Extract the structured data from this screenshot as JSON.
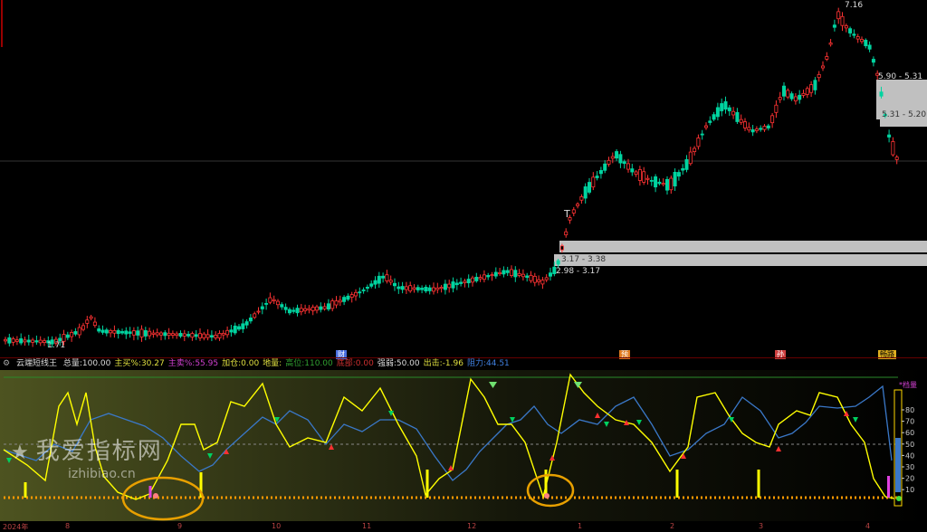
{
  "main_chart": {
    "price_high_label": "7.16",
    "price_low_label": "1.71",
    "ranges": [
      "5.90 - 5.31",
      "5.31 - 5.20",
      "3.17 - 3.38",
      "2.98 - 3.17"
    ],
    "tick_mark": "T"
  },
  "event_markers": [
    {
      "label": "财",
      "color": "#4a6ee0"
    },
    {
      "label": "预",
      "color": "#e07a1f"
    },
    {
      "label": "孙",
      "color": "#d04040"
    },
    {
      "label": "畅路",
      "color": "#e0b020"
    }
  ],
  "indicator": {
    "name": "云端短线王",
    "fields": [
      {
        "label": "总量:",
        "value": "100.00",
        "color": "#dddddd"
      },
      {
        "label": "主买%:",
        "value": "30.27",
        "color": "#e0e040"
      },
      {
        "label": "主卖%:",
        "value": "55.95",
        "color": "#d040d0"
      },
      {
        "label": "加仓:",
        "value": "0.00",
        "color": "#e0e040"
      },
      {
        "label": "地量:",
        "value": "",
        "color": "#e0e040"
      },
      {
        "label": "高位:",
        "value": "110.00",
        "color": "#30a030"
      },
      {
        "label": "底部:",
        "value": "0.00",
        "color": "#d03030"
      },
      {
        "label": "强弱:",
        "value": "50.00",
        "color": "#dddddd"
      },
      {
        "label": "出击:",
        "value": "-1.96",
        "color": "#e0e040"
      },
      {
        "label": "阻力:",
        "value": "44.51",
        "color": "#4080e0"
      }
    ],
    "y_ticks": [
      "80",
      "70",
      "60",
      "50",
      "40",
      "30",
      "20",
      "10"
    ],
    "corner_label": "*档量"
  },
  "date_axis": {
    "labels": [
      "2024年",
      "8",
      "9",
      "10",
      "11",
      "12",
      "1",
      "2",
      "3",
      "4"
    ]
  },
  "watermark": {
    "text": "我爱指标网",
    "url": "izhibiao.cn"
  },
  "colors": {
    "up": "#ff3333",
    "down": "#00d4a0",
    "yellow_line": "#ffff00",
    "blue_line": "#3a78c8",
    "dotted": "#ff9900"
  }
}
